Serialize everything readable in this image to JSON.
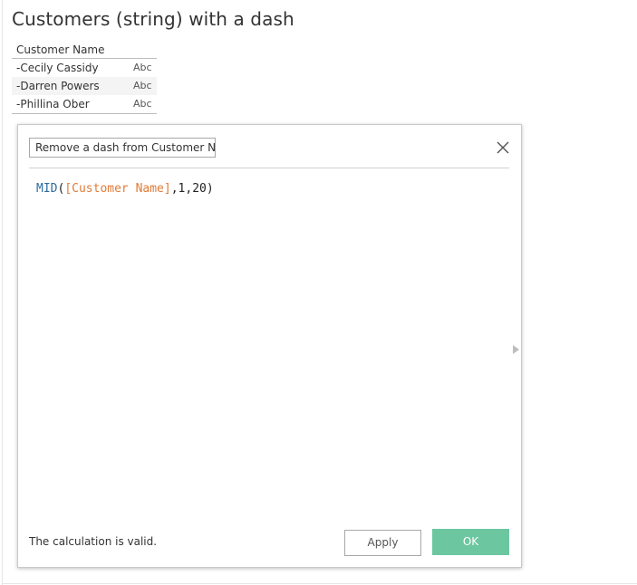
{
  "sheet": {
    "title": "Customers (string) with a dash"
  },
  "table": {
    "column_header": "Customer Name",
    "rows": [
      {
        "name": "-Cecily Cassidy",
        "type": "Abc"
      },
      {
        "name": "-Darren Powers",
        "type": "Abc"
      },
      {
        "name": "-Phillina Ober",
        "type": "Abc"
      }
    ]
  },
  "dialog": {
    "calc_name": "Remove a dash from Customer Name",
    "formula": {
      "function": "MID",
      "open_paren": "(",
      "field": "[Customer Name]",
      "args": ",1,20",
      "close_paren": ")"
    },
    "status": "The calculation is valid.",
    "apply_label": "Apply",
    "ok_label": "OK",
    "close_icon": "close-icon",
    "expand_icon": "triangle-right-icon"
  },
  "colors": {
    "ok_button": "#6cc7a0",
    "function_token": "#2e6b9e",
    "field_token": "#e07b39"
  }
}
